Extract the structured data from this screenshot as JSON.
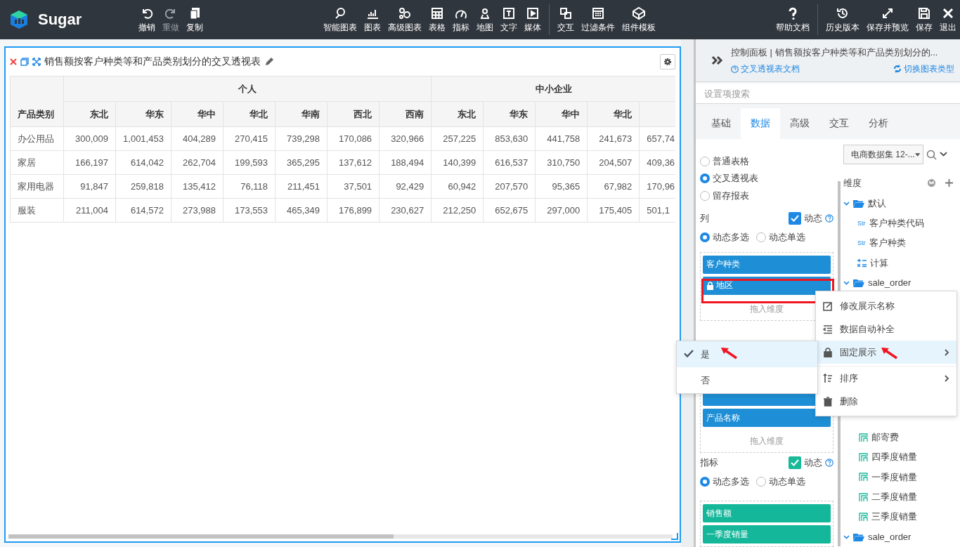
{
  "app": {
    "name": "Sugar"
  },
  "toolbar": {
    "groups": [
      [
        {
          "label": "撤销",
          "disabled": false
        },
        {
          "label": "重做",
          "disabled": true
        },
        {
          "label": "复制",
          "disabled": false
        }
      ],
      [
        {
          "label": "智能图表",
          "disabled": false
        },
        {
          "label": "图表",
          "disabled": false
        },
        {
          "label": "高级图表",
          "disabled": false
        },
        {
          "label": "表格",
          "disabled": false
        },
        {
          "label": "指标",
          "disabled": false
        },
        {
          "label": "地图",
          "disabled": false
        },
        {
          "label": "文字",
          "disabled": false
        },
        {
          "label": "媒体",
          "disabled": false
        }
      ],
      [
        {
          "label": "交互",
          "disabled": false
        },
        {
          "label": "过滤条件",
          "disabled": false
        },
        {
          "label": "组件模板",
          "disabled": false
        }
      ],
      [
        {
          "label": "帮助文档",
          "disabled": false
        }
      ],
      [
        {
          "label": "历史版本",
          "disabled": false
        },
        {
          "label": "保存并预览",
          "disabled": false
        },
        {
          "label": "保存",
          "disabled": false
        },
        {
          "label": "退出",
          "disabled": false
        }
      ]
    ]
  },
  "chart": {
    "title": "销售额按客户种类等和产品类别划分的交叉透视表",
    "table": {
      "row_header": "产品类别",
      "column_groups": [
        {
          "label": "个人",
          "columns": [
            "东北",
            "华东",
            "华中",
            "华北",
            "华南",
            "西北",
            "西南"
          ]
        },
        {
          "label": "中小企业",
          "columns": [
            "东北",
            "华东",
            "华中",
            "华北"
          ]
        }
      ],
      "rows": [
        {
          "label": "办公用品",
          "cells": [
            "300,009",
            "1,001,453",
            "404,289",
            "270,415",
            "739,298",
            "170,086",
            "320,966",
            "257,225",
            "853,630",
            "441,758",
            "241,673",
            "657,74"
          ]
        },
        {
          "label": "家居",
          "cells": [
            "166,197",
            "614,042",
            "262,704",
            "199,593",
            "365,295",
            "137,612",
            "188,494",
            "140,399",
            "616,537",
            "310,750",
            "204,507",
            "409,36"
          ]
        },
        {
          "label": "家用电器",
          "cells": [
            "91,847",
            "259,818",
            "135,412",
            "76,118",
            "211,451",
            "37,501",
            "92,429",
            "60,942",
            "207,570",
            "95,365",
            "67,982",
            "170,96"
          ]
        },
        {
          "label": "服装",
          "cells": [
            "211,004",
            "614,572",
            "273,988",
            "173,553",
            "465,349",
            "176,899",
            "230,627",
            "212,250",
            "652,675",
            "297,000",
            "175,405",
            "501,1"
          ]
        }
      ]
    }
  },
  "panel": {
    "title": "控制面板 | 销售额按客户种类等和产品类别划分的...",
    "doc_link": "交叉透视表文档",
    "switch_link": "切换图表类型",
    "search": {
      "placeholder": "设置项搜索"
    },
    "tabs": [
      {
        "label": "基础",
        "selected": false
      },
      {
        "label": "数据",
        "selected": true
      },
      {
        "label": "高级",
        "selected": false
      },
      {
        "label": "交互",
        "selected": false
      },
      {
        "label": "分析",
        "selected": false
      }
    ],
    "table_types": [
      {
        "label": "普通表格",
        "selected": false
      },
      {
        "label": "交叉透视表",
        "selected": true
      },
      {
        "label": "留存报表",
        "selected": false
      }
    ],
    "columns_section": {
      "label": "列",
      "dynamic": {
        "label": "动态",
        "checked": true
      },
      "modes": [
        {
          "label": "动态多选",
          "selected": true
        },
        {
          "label": "动态单选",
          "selected": false
        }
      ],
      "chips": [
        {
          "label": "客户种类",
          "locked": false
        },
        {
          "label": "地区",
          "locked": true
        }
      ],
      "drop_hint": "拖入维度"
    },
    "rows_section": {
      "chips": [
        {
          "label": "产品名称",
          "locked": false
        }
      ],
      "drop_hint": "拖入维度"
    },
    "measures_section": {
      "label": "指标",
      "dynamic": {
        "label": "动态",
        "checked": true
      },
      "modes": [
        {
          "label": "动态多选",
          "selected": true
        },
        {
          "label": "动态单选",
          "selected": false
        }
      ],
      "chips": [
        {
          "label": "销售额"
        },
        {
          "label": "一季度销量"
        }
      ]
    },
    "dataset": {
      "value": "电商数据集 12-..."
    },
    "dimensions": {
      "label": "维度",
      "tree": [
        {
          "label": "默认",
          "expanded": true,
          "children": [
            {
              "label": "客户种类代码",
              "kind": "string",
              "badge": "Str"
            },
            {
              "label": "客户种类",
              "kind": "string",
              "badge": "Str"
            },
            {
              "label": "计算",
              "kind": "calc"
            }
          ]
        },
        {
          "label": "sale_order",
          "expanded": true
        }
      ]
    },
    "measures": [
      {
        "label": "邮寄费"
      },
      {
        "label": "四季度销量"
      },
      {
        "label": "一季度销量"
      },
      {
        "label": "二季度销量"
      },
      {
        "label": "三季度销量"
      }
    ],
    "tree_more": [
      {
        "label": "sale_order",
        "expanded": true
      }
    ]
  },
  "context_menu": {
    "items": [
      {
        "label": "修改展示名称",
        "submenu": false,
        "highlighted": false,
        "divider_before": false
      },
      {
        "label": "数据自动补全",
        "submenu": false,
        "highlighted": false,
        "divider_before": false
      },
      {
        "label": "固定展示",
        "submenu": true,
        "highlighted": true,
        "divider_before": false
      },
      {
        "label": "排序",
        "submenu": true,
        "highlighted": false,
        "divider_before": true
      },
      {
        "label": "删除",
        "submenu": false,
        "highlighted": false,
        "divider_before": false
      }
    ],
    "submenu": [
      {
        "label": "是",
        "selected": true
      },
      {
        "label": "否",
        "selected": false
      }
    ]
  }
}
